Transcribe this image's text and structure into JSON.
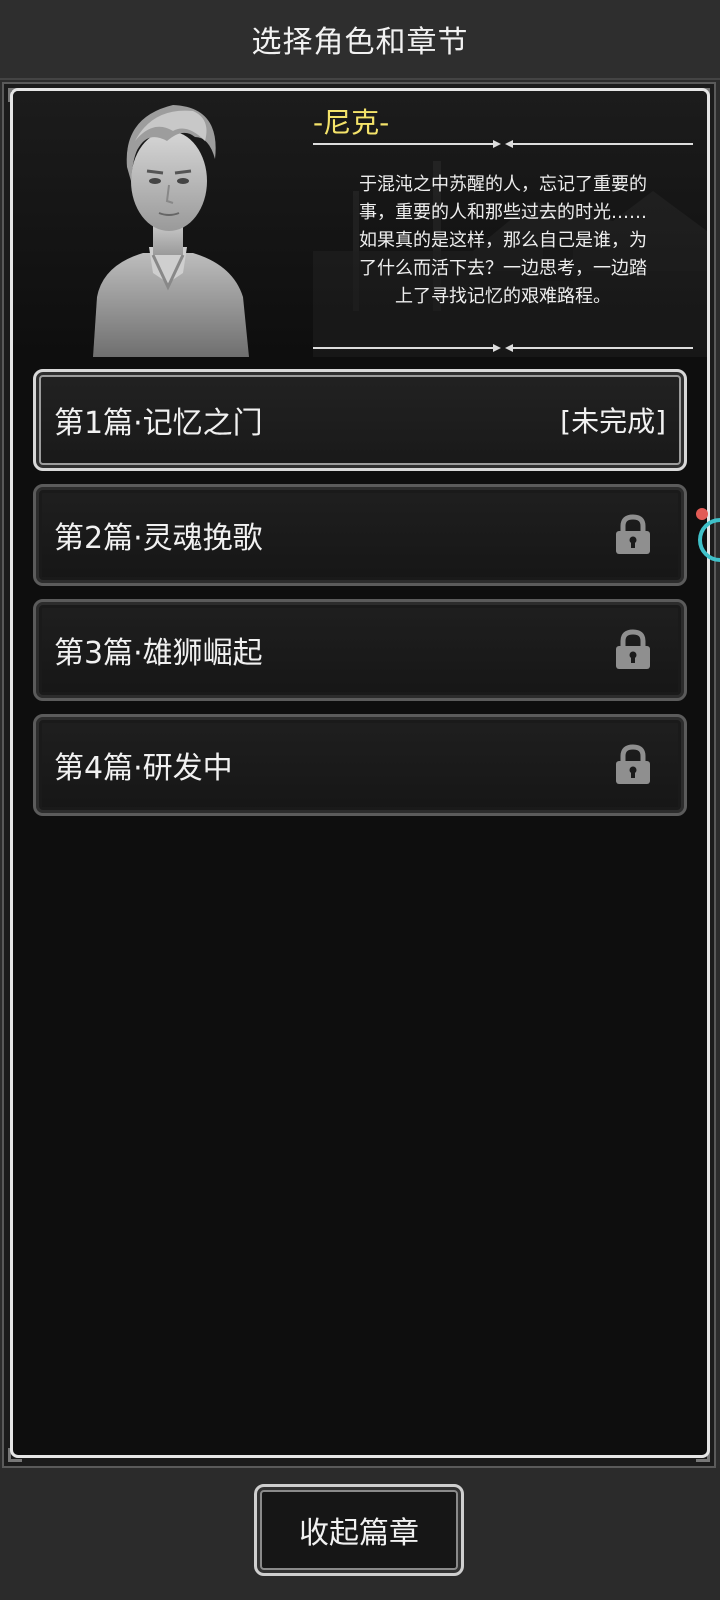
{
  "header": {
    "title": "选择角色和章节"
  },
  "character": {
    "name": "-尼克-",
    "description": "于混沌之中苏醒的人，忘记了重要的\n事，重要的人和那些过去的时光……\n如果真的是这样，那么自己是谁，为\n了什么而活下去？一边思考，一边踏\n上了寻找记忆的艰难路程。"
  },
  "chapters": [
    {
      "label": "第1篇·记忆之门",
      "status": "[未完成]",
      "locked": false
    },
    {
      "label": "第2篇·灵魂挽歌",
      "locked": true,
      "icon": "lock-icon"
    },
    {
      "label": "第3篇·雄狮崛起",
      "locked": true,
      "icon": "lock-icon"
    },
    {
      "label": "第4篇·研发中",
      "locked": true,
      "icon": "lock-icon"
    }
  ],
  "footer": {
    "collapse_label": "收起篇章"
  },
  "colors": {
    "name_accent": "#f4e36a",
    "notification_dot": "#e25b55",
    "edge_ring": "#3fc1c9"
  }
}
